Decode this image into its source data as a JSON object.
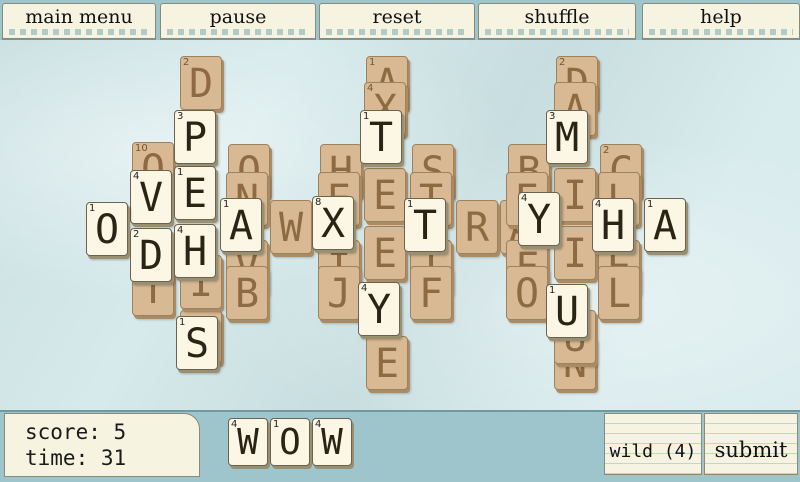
{
  "menu": {
    "main_menu": "main menu",
    "pause": "pause",
    "reset": "reset",
    "shuffle": "shuffle",
    "help": "help"
  },
  "status": {
    "score": "score: 5",
    "time": "time: 31"
  },
  "current_word": [
    {
      "letter": "W",
      "points": "4"
    },
    {
      "letter": "O",
      "points": "1"
    },
    {
      "letter": "W",
      "points": "4"
    }
  ],
  "actions": {
    "wild": "wild (4)",
    "submit": "submit"
  },
  "tiles": [
    {
      "l": "D",
      "n": "2",
      "top": 1
    },
    {
      "l": "B",
      "n": "2",
      "top": 1
    },
    {
      "l": "P",
      "n": "3",
      "top": 0
    },
    {
      "l": "E",
      "n": "",
      "top": 1
    },
    {
      "l": "O",
      "n": "",
      "top": 1
    },
    {
      "l": "V",
      "n": "4",
      "top": 0
    },
    {
      "l": "E",
      "n": "1",
      "top": 0
    },
    {
      "l": "O",
      "n": "1",
      "top": 0
    },
    {
      "l": "D",
      "n": "2",
      "top": 0
    },
    {
      "l": "H",
      "n": "4",
      "top": 0
    },
    {
      "l": "A",
      "n": "1",
      "top": 0
    },
    {
      "l": "W",
      "n": "",
      "top": 1
    },
    {
      "l": "S",
      "n": "1",
      "top": 0
    },
    {
      "l": "X",
      "n": "8",
      "top": 0
    },
    {
      "l": "T",
      "n": "1",
      "top": 0
    },
    {
      "l": "E",
      "n": "",
      "top": 1
    },
    {
      "l": "T",
      "n": "1",
      "top": 0
    },
    {
      "l": "R",
      "n": "",
      "top": 1
    },
    {
      "l": "A",
      "n": "",
      "top": 1
    },
    {
      "l": "Y",
      "n": "4",
      "top": 0
    },
    {
      "l": "M",
      "n": "3",
      "top": 0
    },
    {
      "l": "Y",
      "n": "4",
      "top": 0
    },
    {
      "l": "H",
      "n": "4",
      "top": 0
    },
    {
      "l": "A",
      "n": "1",
      "top": 0
    },
    {
      "l": "U",
      "n": "1",
      "top": 0
    },
    {
      "l": "N",
      "n": "",
      "top": 1
    },
    {
      "l": "E",
      "n": "",
      "top": 1
    },
    {
      "l": "S",
      "n": "",
      "top": 1
    }
  ]
}
